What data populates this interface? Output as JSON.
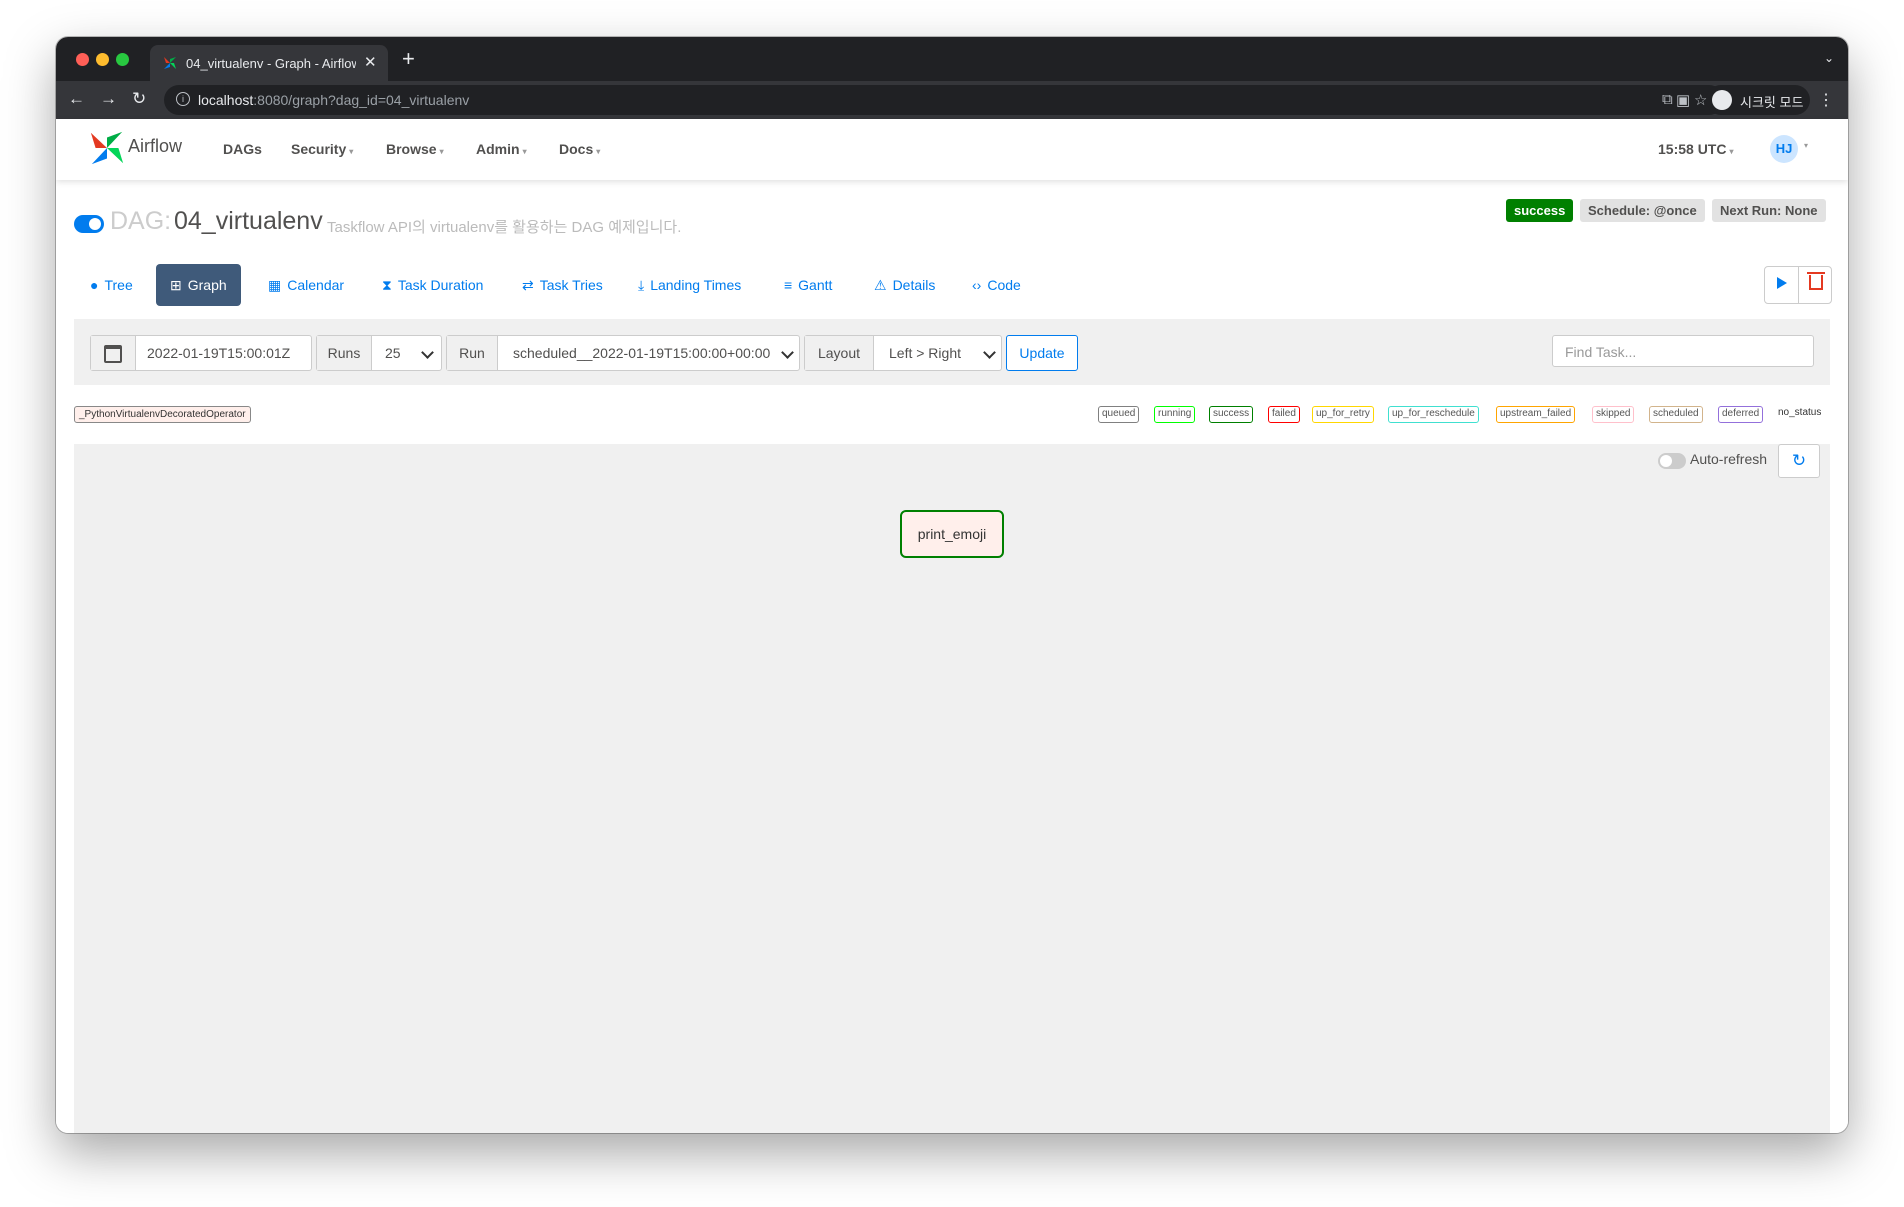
{
  "browser": {
    "tab_title": "04_virtualenv - Graph - Airflow",
    "url_host": "localhost",
    "url_rest": ":8080/graph?dag_id=04_virtualenv",
    "incognito_label": "시크릿 모드"
  },
  "navbar": {
    "brand": "Airflow",
    "menu": [
      "DAGs",
      "Security",
      "Browse",
      "Admin",
      "Docs"
    ],
    "clock": "15:58 UTC",
    "avatar": "HJ"
  },
  "dag": {
    "prefix": "DAG:",
    "name": "04_virtualenv",
    "description": "Taskflow API의 virtualenv를 활용하는 DAG 예제입니다.",
    "status": "success",
    "schedule": "Schedule: @once",
    "next_run": "Next Run: None",
    "paused": false
  },
  "views": [
    "Tree",
    "Graph",
    "Calendar",
    "Task Duration",
    "Task Tries",
    "Landing Times",
    "Gantt",
    "Details",
    "Code"
  ],
  "active_view": "Graph",
  "toolbar": {
    "base_date": "2022-01-19T15:00:01Z",
    "runs_label": "Runs",
    "runs_value": "25",
    "run_label": "Run",
    "run_value": "scheduled__2022-01-19T15:00:00+00:00",
    "layout_label": "Layout",
    "layout_value": "Left > Right",
    "update_label": "Update",
    "find_placeholder": "Find Task..."
  },
  "operator_chip": "_PythonVirtualenvDecoratedOperator",
  "legend": [
    "queued",
    "running",
    "success",
    "failed",
    "up_for_retry",
    "up_for_reschedule",
    "upstream_failed",
    "skipped",
    "scheduled",
    "deferred",
    "no_status"
  ],
  "legend_colors": {
    "queued": "#808080",
    "running": "#00ff00",
    "success": "#008000",
    "failed": "#ff0000",
    "up_for_retry": "#ffd700",
    "up_for_reschedule": "#40e0d0",
    "upstream_failed": "#ffa500",
    "skipped": "#ffc0cb",
    "scheduled": "#d2b48c",
    "deferred": "#9370db"
  },
  "graph": {
    "auto_refresh_label": "Auto-refresh",
    "auto_refresh": false,
    "tasks": [
      {
        "id": "print_emoji",
        "state": "success"
      }
    ]
  },
  "colors": {
    "accent": "#017cee",
    "success": "#008000",
    "active_tab": "#3f5a7a"
  }
}
